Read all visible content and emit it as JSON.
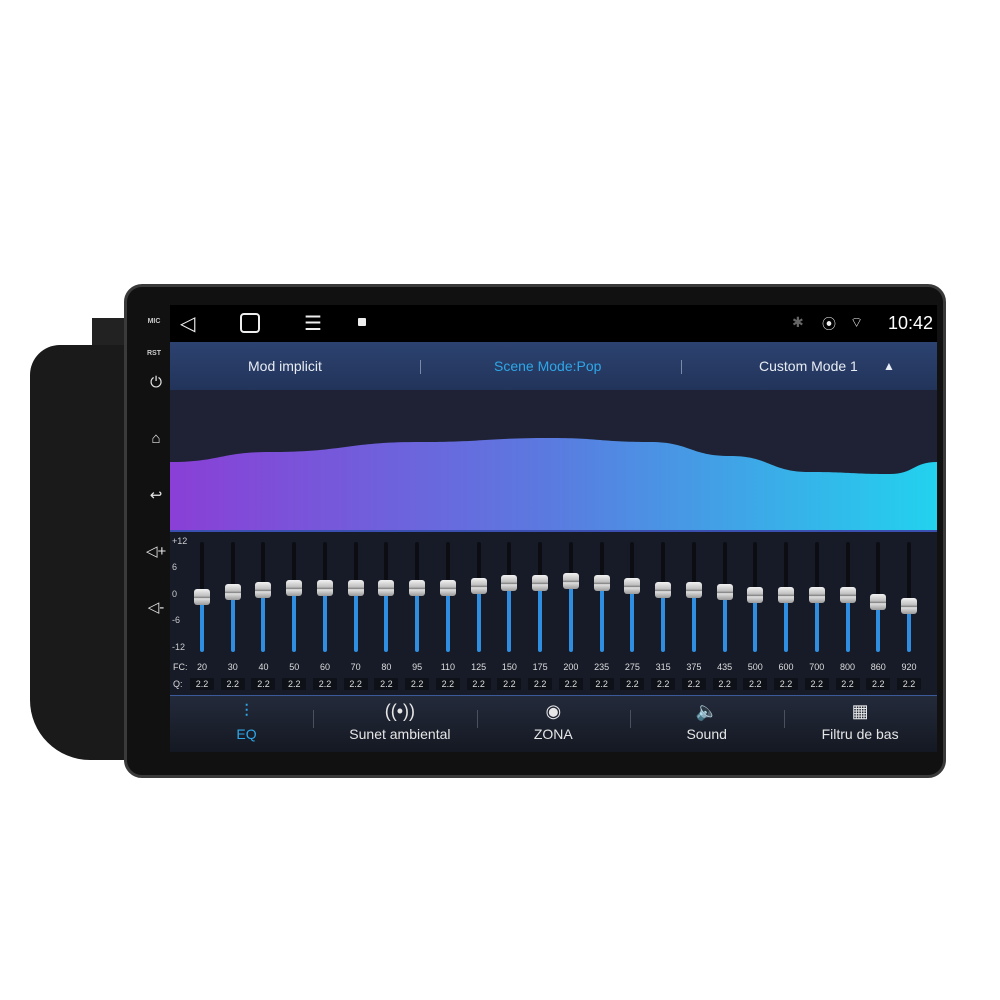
{
  "device": {
    "side_labels": {
      "mic": "MIC",
      "rst": "RST"
    },
    "side_buttons": [
      {
        "name": "power-icon",
        "glyph": "⏻"
      },
      {
        "name": "home-icon",
        "glyph": "⌂"
      },
      {
        "name": "back-icon",
        "glyph": "↩"
      },
      {
        "name": "volume-up-icon",
        "glyph": "◁+"
      },
      {
        "name": "volume-down-icon",
        "glyph": "◁-"
      }
    ]
  },
  "status_bar": {
    "time": "10:42",
    "icons": [
      "bluetooth-icon",
      "location-icon",
      "wifi-icon"
    ]
  },
  "mode_bar": {
    "left": "Mod implicit",
    "center": "Scene Mode:Pop",
    "right": "Custom Mode 1",
    "accent": "#2ea7e8"
  },
  "eq": {
    "y_ticks": [
      "+12",
      "6",
      "0",
      "-6",
      "-12"
    ],
    "range": [
      -12,
      12
    ],
    "fc_label": "FC:",
    "q_label": "Q:",
    "bands": [
      {
        "fc": "20",
        "q": "2.2",
        "gain": 0
      },
      {
        "fc": "30",
        "q": "2.2",
        "gain": 1
      },
      {
        "fc": "40",
        "q": "2.2",
        "gain": 1.5
      },
      {
        "fc": "50",
        "q": "2.2",
        "gain": 2
      },
      {
        "fc": "60",
        "q": "2.2",
        "gain": 2
      },
      {
        "fc": "70",
        "q": "2.2",
        "gain": 2
      },
      {
        "fc": "80",
        "q": "2.2",
        "gain": 2
      },
      {
        "fc": "95",
        "q": "2.2",
        "gain": 2
      },
      {
        "fc": "110",
        "q": "2.2",
        "gain": 2
      },
      {
        "fc": "125",
        "q": "2.2",
        "gain": 2.5
      },
      {
        "fc": "150",
        "q": "2.2",
        "gain": 3
      },
      {
        "fc": "175",
        "q": "2.2",
        "gain": 3
      },
      {
        "fc": "200",
        "q": "2.2",
        "gain": 3.5
      },
      {
        "fc": "235",
        "q": "2.2",
        "gain": 3
      },
      {
        "fc": "275",
        "q": "2.2",
        "gain": 2.5
      },
      {
        "fc": "315",
        "q": "2.2",
        "gain": 1.5
      },
      {
        "fc": "375",
        "q": "2.2",
        "gain": 1.5
      },
      {
        "fc": "435",
        "q": "2.2",
        "gain": 1
      },
      {
        "fc": "500",
        "q": "2.2",
        "gain": 0.5
      },
      {
        "fc": "600",
        "q": "2.2",
        "gain": 0.5
      },
      {
        "fc": "700",
        "q": "2.2",
        "gain": 0.5
      },
      {
        "fc": "800",
        "q": "2.2",
        "gain": 0.5
      },
      {
        "fc": "860",
        "q": "2.2",
        "gain": -1
      },
      {
        "fc": "920",
        "q": "2.2",
        "gain": -2
      }
    ]
  },
  "tabs": [
    {
      "label": "EQ",
      "icon": "equalizer-icon",
      "glyph": "⫶",
      "active": true
    },
    {
      "label": "Sunet ambiental",
      "icon": "surround-icon",
      "glyph": "((•))",
      "active": false
    },
    {
      "label": "ZONA",
      "icon": "zone-target-icon",
      "glyph": "◉",
      "active": false
    },
    {
      "label": "Sound",
      "icon": "speaker-icon",
      "glyph": "🔈",
      "active": false
    },
    {
      "label": "Filtru de bas",
      "icon": "bass-filter-icon",
      "glyph": "▦",
      "active": false
    }
  ]
}
